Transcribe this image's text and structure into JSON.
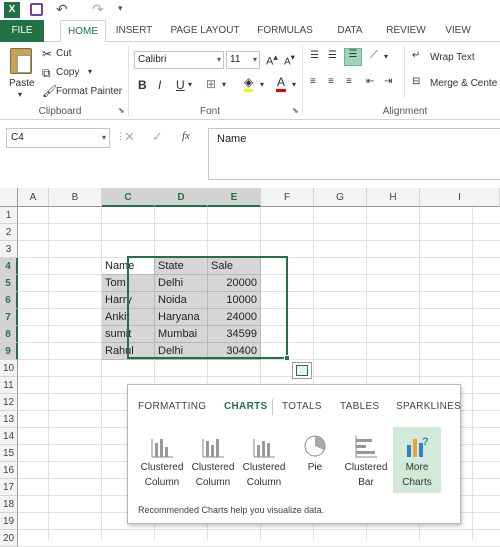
{
  "qat": {
    "app_icon": "excel-icon",
    "save_icon": "save-icon",
    "undo_icon": "undo-icon",
    "redo_icon": "redo-icon"
  },
  "tabs": [
    "FILE",
    "HOME",
    "INSERT",
    "PAGE LAYOUT",
    "FORMULAS",
    "DATA",
    "REVIEW",
    "VIEW"
  ],
  "ribbon": {
    "clipboard": {
      "paste": "Paste",
      "cut": "Cut",
      "copy": "Copy",
      "format_painter": "Format Painter",
      "label": "Clipboard"
    },
    "font": {
      "name": "Calibri",
      "size": "11",
      "bold": "B",
      "italic": "I",
      "underline": "U",
      "font_color_letter": "A",
      "label": "Font"
    },
    "alignment": {
      "wrap_text": "Wrap Text",
      "merge": "Merge & Cente",
      "label": "Alignment"
    }
  },
  "formula_bar": {
    "name_box": "C4",
    "fx": "fx",
    "content": "Name"
  },
  "columns": [
    "A",
    "B",
    "C",
    "D",
    "E",
    "F",
    "G",
    "H",
    "I"
  ],
  "rows": [
    "1",
    "2",
    "3",
    "4",
    "5",
    "6",
    "7",
    "8",
    "9",
    "10",
    "11",
    "12",
    "13",
    "14",
    "15",
    "16",
    "17",
    "18",
    "19",
    "20"
  ],
  "table": {
    "header": [
      "Name",
      "State",
      "Sale"
    ],
    "rows": [
      [
        "Tom",
        "Delhi",
        "20000"
      ],
      [
        "Harry",
        "Noida",
        "10000"
      ],
      [
        "Ankit",
        "Haryana",
        "24000"
      ],
      [
        "sumit",
        "Mumbai",
        "34599"
      ],
      [
        "Rahul",
        "Delhi",
        "30400"
      ]
    ]
  },
  "quick_analysis": {
    "tabs": [
      "FORMATTING",
      "CHARTS",
      "TOTALS",
      "TABLES",
      "SPARKLINES"
    ],
    "active_tab": "CHARTS",
    "items": [
      {
        "line1": "Clustered",
        "line2": "Column",
        "icon": "clustered-column-icon"
      },
      {
        "line1": "Clustered",
        "line2": "Column",
        "icon": "clustered-column-icon"
      },
      {
        "line1": "Clustered",
        "line2": "Column",
        "icon": "clustered-column-icon"
      },
      {
        "line1": "Pie",
        "line2": "",
        "icon": "pie-chart-icon"
      },
      {
        "line1": "Clustered",
        "line2": "Bar",
        "icon": "clustered-bar-icon"
      },
      {
        "line1": "More",
        "line2": "Charts",
        "icon": "more-charts-icon"
      }
    ],
    "description": "Recommended Charts help you visualize data."
  },
  "colors": {
    "accent": "#217346",
    "selection": "#d6d6d6",
    "highlight": "#d2ead9"
  }
}
